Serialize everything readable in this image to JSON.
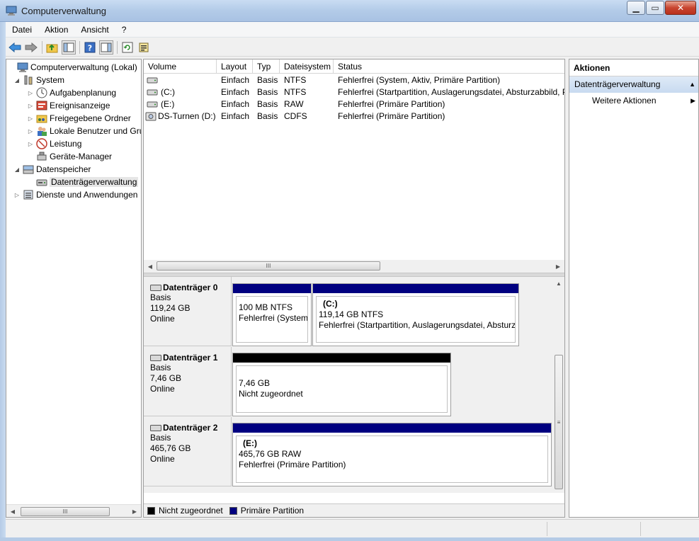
{
  "window": {
    "title": "Computerverwaltung",
    "min": "▁",
    "max": "▭",
    "close": "✕"
  },
  "menu": [
    "Datei",
    "Aktion",
    "Ansicht",
    "?"
  ],
  "tree": {
    "items": [
      {
        "label": "Computerverwaltung (Lokal)",
        "level": 0,
        "twisty": "",
        "icon": "computer-management-icon"
      },
      {
        "label": "System",
        "level": 1,
        "twisty": "◢",
        "icon": "system-tools-icon"
      },
      {
        "label": "Aufgabenplanung",
        "level": 2,
        "twisty": "▷",
        "icon": "task-scheduler-icon"
      },
      {
        "label": "Ereignisanzeige",
        "level": 2,
        "twisty": "▷",
        "icon": "event-viewer-icon"
      },
      {
        "label": "Freigegebene Ordner",
        "level": 2,
        "twisty": "▷",
        "icon": "shared-folders-icon"
      },
      {
        "label": "Lokale Benutzer und Gru",
        "level": 2,
        "twisty": "▷",
        "icon": "local-users-icon"
      },
      {
        "label": "Leistung",
        "level": 2,
        "twisty": "▷",
        "icon": "performance-icon"
      },
      {
        "label": "Geräte-Manager",
        "level": 2,
        "twisty": "",
        "icon": "device-manager-icon"
      },
      {
        "label": "Datenspeicher",
        "level": 1,
        "twisty": "◢",
        "icon": "storage-icon"
      },
      {
        "label": "Datenträgerverwaltung",
        "level": 2,
        "twisty": "",
        "icon": "disk-management-icon",
        "selected": true
      },
      {
        "label": "Dienste und Anwendungen",
        "level": 1,
        "twisty": "▷",
        "icon": "services-icon"
      }
    ],
    "scroll_thumb": "III"
  },
  "volumes": {
    "columns": [
      "Volume",
      "Layout",
      "Typ",
      "Dateisystem",
      "Status"
    ],
    "rows": [
      {
        "volume": "",
        "layout": "Einfach",
        "type": "Basis",
        "fs": "NTFS",
        "status": "Fehlerfrei (System, Aktiv, Primäre Partition)",
        "icon": "hdd-icon"
      },
      {
        "volume": "(C:)",
        "layout": "Einfach",
        "type": "Basis",
        "fs": "NTFS",
        "status": "Fehlerfrei (Startpartition, Auslagerungsdatei, Absturzabbild, P",
        "icon": "hdd-icon"
      },
      {
        "volume": "(E:)",
        "layout": "Einfach",
        "type": "Basis",
        "fs": "RAW",
        "status": "Fehlerfrei (Primäre Partition)",
        "icon": "hdd-icon"
      },
      {
        "volume": "DS-Turnen (D:)",
        "layout": "Einfach",
        "type": "Basis",
        "fs": "CDFS",
        "status": "Fehlerfrei (Primäre Partition)",
        "icon": "cd-drive-icon"
      }
    ],
    "scroll_thumb": "III"
  },
  "disks": [
    {
      "name": "Datenträger 0",
      "kind": "Basis",
      "size": "119,24 GB",
      "state": "Online",
      "partitions": [
        {
          "name": "",
          "line1": "100 MB NTFS",
          "line2": "Fehlerfrei (System,",
          "color": "#000080"
        },
        {
          "name": "(C:)",
          "line1": "119,14 GB NTFS",
          "line2": "Fehlerfrei (Startpartition, Auslagerungsdatei, Absturz",
          "color": "#000080"
        }
      ]
    },
    {
      "name": "Datenträger 1",
      "kind": "Basis",
      "size": "7,46 GB",
      "state": "Online",
      "partitions": [
        {
          "name": "",
          "line1": "7,46 GB",
          "line2": "Nicht zugeordnet",
          "color": "#000000"
        }
      ]
    },
    {
      "name": "Datenträger 2",
      "kind": "Basis",
      "size": "465,76 GB",
      "state": "Online",
      "partitions": [
        {
          "name": "(E:)",
          "line1": "465,76 GB RAW",
          "line2": "Fehlerfrei (Primäre Partition)",
          "color": "#000080"
        }
      ]
    }
  ],
  "legend": [
    {
      "label": "Nicht zugeordnet",
      "color": "#000000"
    },
    {
      "label": "Primäre Partition",
      "color": "#000080"
    }
  ],
  "actions": {
    "header": "Aktionen",
    "section": "Datenträgerverwaltung",
    "items": [
      "Weitere Aktionen"
    ]
  },
  "colors": {
    "accent": "#000080",
    "unallocated": "#000000",
    "selection": "#e6e6e6"
  }
}
